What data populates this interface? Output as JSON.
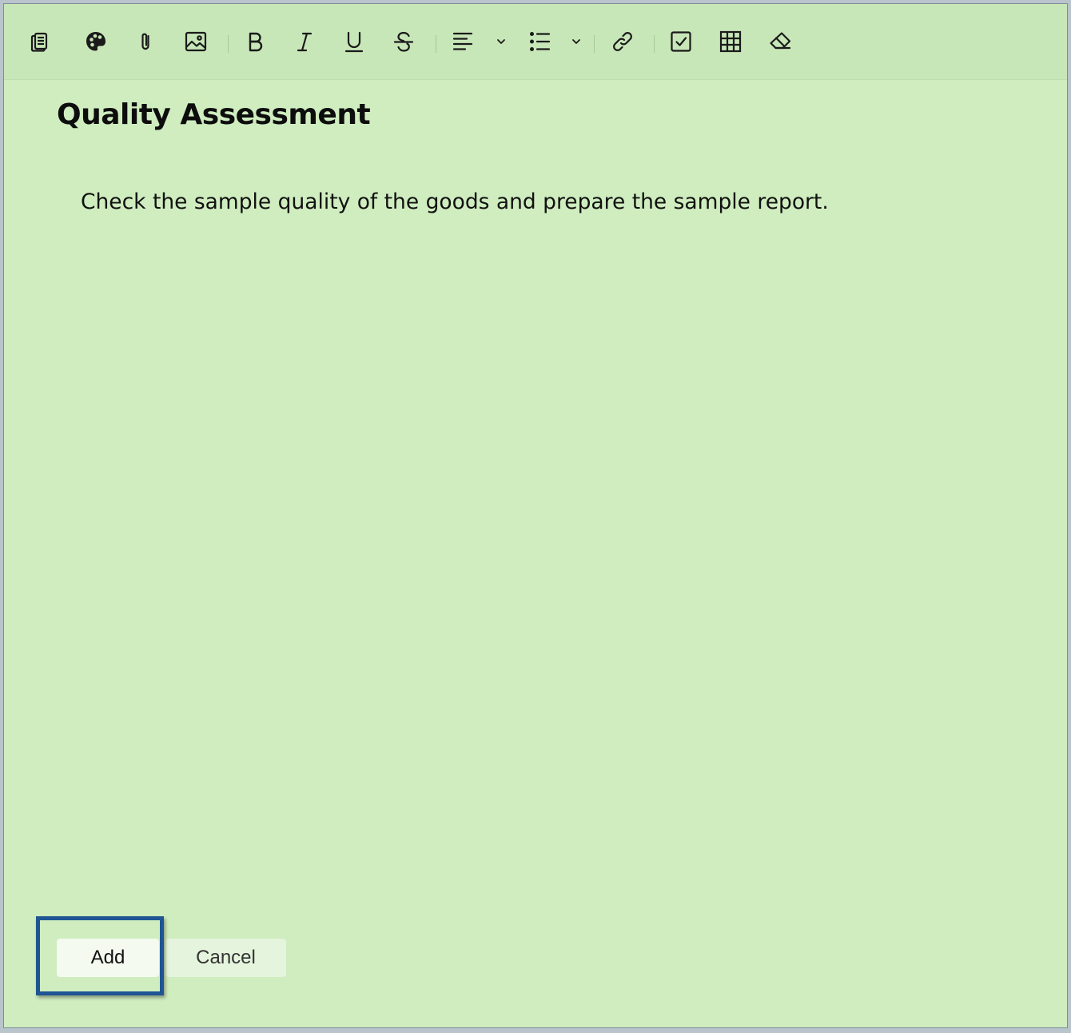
{
  "toolbar": {
    "items": [
      {
        "name": "notes-icon",
        "tooltip": "Note style"
      },
      {
        "name": "palette-icon",
        "tooltip": "Color"
      },
      {
        "name": "paperclip-icon",
        "tooltip": "Attach"
      },
      {
        "name": "image-icon",
        "tooltip": "Image"
      },
      {
        "name": "bold-icon",
        "tooltip": "Bold"
      },
      {
        "name": "italic-icon",
        "tooltip": "Italic"
      },
      {
        "name": "underline-icon",
        "tooltip": "Underline"
      },
      {
        "name": "strikethrough-icon",
        "tooltip": "Strikethrough"
      },
      {
        "name": "align-left-icon",
        "tooltip": "Align"
      },
      {
        "name": "bulleted-list-icon",
        "tooltip": "List"
      },
      {
        "name": "link-icon",
        "tooltip": "Link"
      },
      {
        "name": "checkbox-icon",
        "tooltip": "Checklist"
      },
      {
        "name": "table-icon",
        "tooltip": "Table"
      },
      {
        "name": "eraser-icon",
        "tooltip": "Clear formatting"
      }
    ]
  },
  "note": {
    "title": "Quality Assessment",
    "body": "Check the sample quality of the goods and prepare the sample report."
  },
  "actions": {
    "add_label": "Add",
    "cancel_label": "Cancel"
  },
  "colors": {
    "note_background": "#cfedbf",
    "toolbar_background": "#c8e7b8",
    "highlight": "#1e5592"
  }
}
